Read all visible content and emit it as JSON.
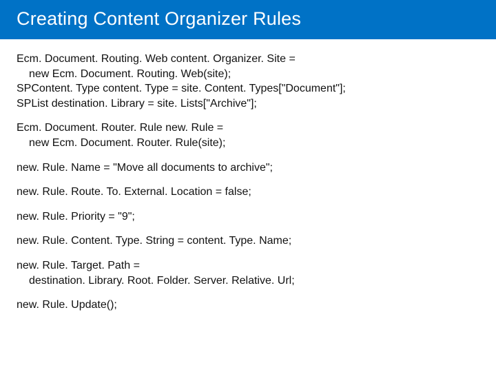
{
  "title": "Creating Content Organizer Rules",
  "code": {
    "b1l1": "Ecm. Document. Routing. Web content. Organizer. Site =",
    "b1l2": "new Ecm. Document. Routing. Web(site);",
    "b1l3": "SPContent. Type content. Type = site. Content. Types[\"Document\"];",
    "b1l4": "SPList destination. Library = site. Lists[\"Archive\"];",
    "b2l1": "Ecm. Document. Router. Rule new. Rule =",
    "b2l2": "new Ecm. Document. Router. Rule(site);",
    "b3": "new. Rule. Name = \"Move all documents to archive\";",
    "b4": "new. Rule. Route. To. External. Location = false;",
    "b5": "new. Rule. Priority = \"9\";",
    "b6": "new. Rule. Content. Type. String = content. Type. Name;",
    "b7l1": "new. Rule. Target. Path =",
    "b7l2": "destination. Library. Root. Folder. Server. Relative. Url;",
    "b8": "new. Rule. Update();"
  }
}
